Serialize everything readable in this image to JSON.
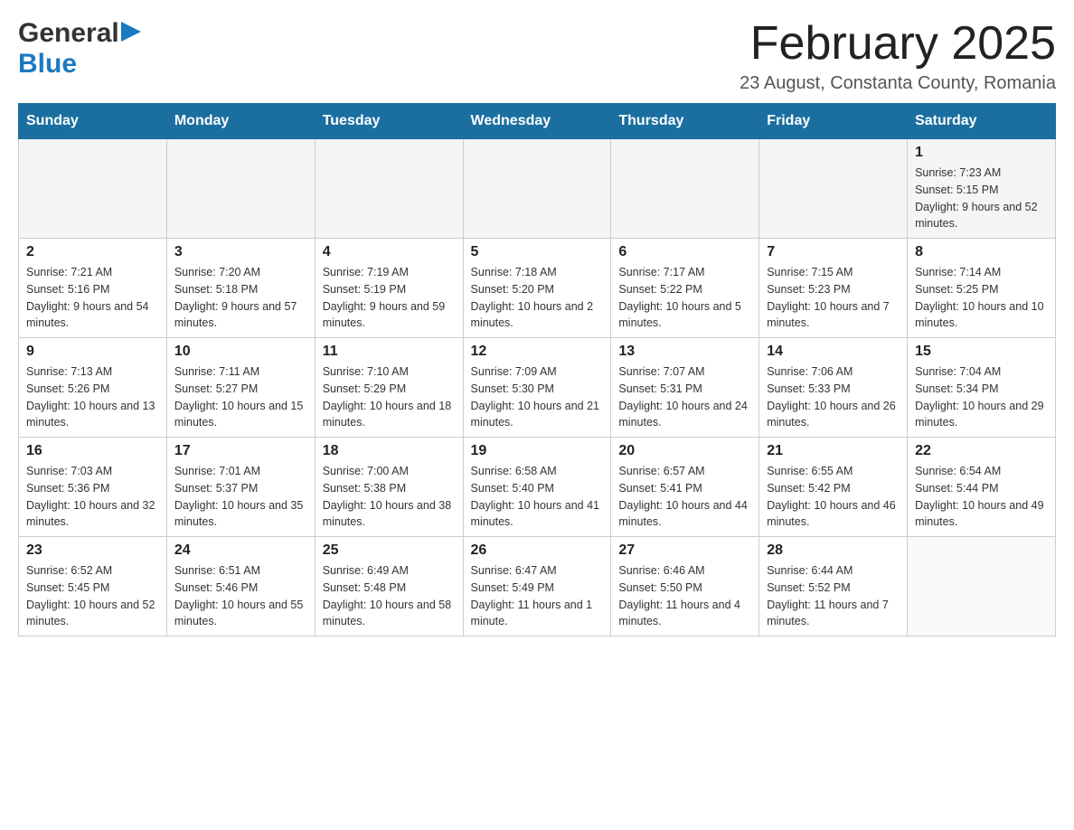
{
  "logo": {
    "general": "General",
    "blue": "Blue",
    "arrow": "▶"
  },
  "title": "February 2025",
  "subtitle": "23 August, Constanta County, Romania",
  "weekdays": [
    "Sunday",
    "Monday",
    "Tuesday",
    "Wednesday",
    "Thursday",
    "Friday",
    "Saturday"
  ],
  "weeks": [
    [
      {
        "day": "",
        "info": ""
      },
      {
        "day": "",
        "info": ""
      },
      {
        "day": "",
        "info": ""
      },
      {
        "day": "",
        "info": ""
      },
      {
        "day": "",
        "info": ""
      },
      {
        "day": "",
        "info": ""
      },
      {
        "day": "1",
        "info": "Sunrise: 7:23 AM\nSunset: 5:15 PM\nDaylight: 9 hours and 52 minutes."
      }
    ],
    [
      {
        "day": "2",
        "info": "Sunrise: 7:21 AM\nSunset: 5:16 PM\nDaylight: 9 hours and 54 minutes."
      },
      {
        "day": "3",
        "info": "Sunrise: 7:20 AM\nSunset: 5:18 PM\nDaylight: 9 hours and 57 minutes."
      },
      {
        "day": "4",
        "info": "Sunrise: 7:19 AM\nSunset: 5:19 PM\nDaylight: 9 hours and 59 minutes."
      },
      {
        "day": "5",
        "info": "Sunrise: 7:18 AM\nSunset: 5:20 PM\nDaylight: 10 hours and 2 minutes."
      },
      {
        "day": "6",
        "info": "Sunrise: 7:17 AM\nSunset: 5:22 PM\nDaylight: 10 hours and 5 minutes."
      },
      {
        "day": "7",
        "info": "Sunrise: 7:15 AM\nSunset: 5:23 PM\nDaylight: 10 hours and 7 minutes."
      },
      {
        "day": "8",
        "info": "Sunrise: 7:14 AM\nSunset: 5:25 PM\nDaylight: 10 hours and 10 minutes."
      }
    ],
    [
      {
        "day": "9",
        "info": "Sunrise: 7:13 AM\nSunset: 5:26 PM\nDaylight: 10 hours and 13 minutes."
      },
      {
        "day": "10",
        "info": "Sunrise: 7:11 AM\nSunset: 5:27 PM\nDaylight: 10 hours and 15 minutes."
      },
      {
        "day": "11",
        "info": "Sunrise: 7:10 AM\nSunset: 5:29 PM\nDaylight: 10 hours and 18 minutes."
      },
      {
        "day": "12",
        "info": "Sunrise: 7:09 AM\nSunset: 5:30 PM\nDaylight: 10 hours and 21 minutes."
      },
      {
        "day": "13",
        "info": "Sunrise: 7:07 AM\nSunset: 5:31 PM\nDaylight: 10 hours and 24 minutes."
      },
      {
        "day": "14",
        "info": "Sunrise: 7:06 AM\nSunset: 5:33 PM\nDaylight: 10 hours and 26 minutes."
      },
      {
        "day": "15",
        "info": "Sunrise: 7:04 AM\nSunset: 5:34 PM\nDaylight: 10 hours and 29 minutes."
      }
    ],
    [
      {
        "day": "16",
        "info": "Sunrise: 7:03 AM\nSunset: 5:36 PM\nDaylight: 10 hours and 32 minutes."
      },
      {
        "day": "17",
        "info": "Sunrise: 7:01 AM\nSunset: 5:37 PM\nDaylight: 10 hours and 35 minutes."
      },
      {
        "day": "18",
        "info": "Sunrise: 7:00 AM\nSunset: 5:38 PM\nDaylight: 10 hours and 38 minutes."
      },
      {
        "day": "19",
        "info": "Sunrise: 6:58 AM\nSunset: 5:40 PM\nDaylight: 10 hours and 41 minutes."
      },
      {
        "day": "20",
        "info": "Sunrise: 6:57 AM\nSunset: 5:41 PM\nDaylight: 10 hours and 44 minutes."
      },
      {
        "day": "21",
        "info": "Sunrise: 6:55 AM\nSunset: 5:42 PM\nDaylight: 10 hours and 46 minutes."
      },
      {
        "day": "22",
        "info": "Sunrise: 6:54 AM\nSunset: 5:44 PM\nDaylight: 10 hours and 49 minutes."
      }
    ],
    [
      {
        "day": "23",
        "info": "Sunrise: 6:52 AM\nSunset: 5:45 PM\nDaylight: 10 hours and 52 minutes."
      },
      {
        "day": "24",
        "info": "Sunrise: 6:51 AM\nSunset: 5:46 PM\nDaylight: 10 hours and 55 minutes."
      },
      {
        "day": "25",
        "info": "Sunrise: 6:49 AM\nSunset: 5:48 PM\nDaylight: 10 hours and 58 minutes."
      },
      {
        "day": "26",
        "info": "Sunrise: 6:47 AM\nSunset: 5:49 PM\nDaylight: 11 hours and 1 minute."
      },
      {
        "day": "27",
        "info": "Sunrise: 6:46 AM\nSunset: 5:50 PM\nDaylight: 11 hours and 4 minutes."
      },
      {
        "day": "28",
        "info": "Sunrise: 6:44 AM\nSunset: 5:52 PM\nDaylight: 11 hours and 7 minutes."
      },
      {
        "day": "",
        "info": ""
      }
    ]
  ]
}
